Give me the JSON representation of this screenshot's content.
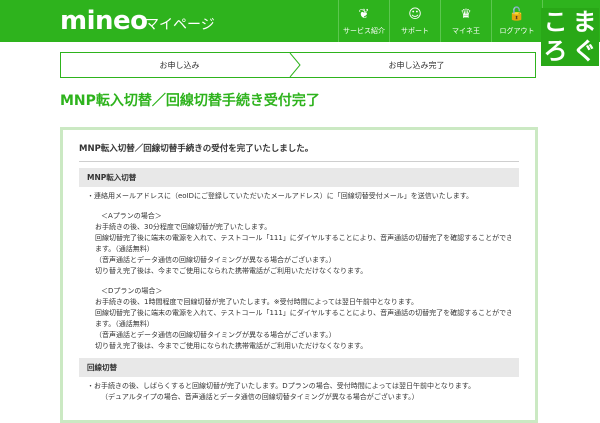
{
  "header": {
    "logo": "mineo",
    "title": "マイページ",
    "nav": [
      {
        "label": "サービス紹介",
        "icon": "❦"
      },
      {
        "label": "サポート",
        "icon": "☺"
      },
      {
        "label": "マイネ王",
        "icon": "♛"
      },
      {
        "label": "ログアウト",
        "icon": "🔓"
      }
    ],
    "watermark": [
      "こ",
      "ま",
      "ろ",
      "ぐ"
    ]
  },
  "steps": [
    "お申し込み",
    "お申し込み完了"
  ],
  "page_title": "MNP転入切替／回線切替手続き受付完了",
  "panel": {
    "heading": "MNP転入切替／回線切替手続きの受付を完了いたしました。",
    "sections": [
      {
        "title": "MNP転入切替",
        "lines": [
          "・連絡用メールアドレスに（eoIDにご登録していただいたメールアドレス）に「回線切替受付メール」を送信いたします。",
          "",
          "＜Aプランの場合＞",
          "お手続きの後、30分程度で回線切替が完了いたします。",
          "回線切替完了後に端末の電源を入れて、テストコール「111」にダイヤルすることにより、音声通話の切替完了を確認することができ",
          "ます。（通話無料）",
          "（音声通話とデータ通信の回線切替タイミングが異なる場合がございます。）",
          "切り替え完了後は、今までご使用になられた携帯電話がご利用いただけなくなります。",
          "",
          "＜Dプランの場合＞",
          "お手続きの後、1時間程度で回線切替が完了いたします。※受付時間によっては翌日午前中となります。",
          "回線切替完了後に端末の電源を入れて、テストコール「111」にダイヤルすることにより、音声通話の切替完了を確認することができ",
          "ます。（通話無料）",
          "（音声通話とデータ通信の回線切替タイミングが異なる場合がございます。）",
          "切り替え完了後は、今までご使用になられた携帯電話がご利用いただけなくなります。"
        ]
      },
      {
        "title": "回線切替",
        "lines": [
          "・お手続きの後、しばらくすると回線切替が完了いたします。Dプランの場合、受付時間によっては翌日午前中となります。",
          "（デュアルタイプの場合、音声通話とデータ通信の回線切替タイミングが異なる場合がございます。）"
        ]
      }
    ]
  },
  "colors": {
    "brand_green": "#2eb31d",
    "panel_border": "#cbe9c3",
    "section_bg": "#e8e8e8"
  }
}
